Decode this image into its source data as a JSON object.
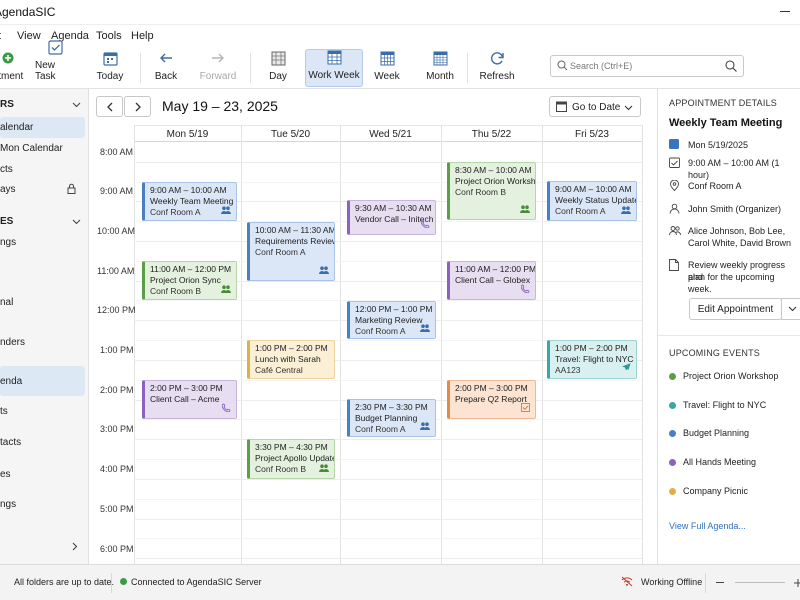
{
  "app": {
    "title": "AgendaSIC"
  },
  "menu": [
    "t",
    "View",
    "Agenda",
    "Tools",
    "Help"
  ],
  "toolbar": {
    "new_appointment": "ntment",
    "new_task": "New Task",
    "today": "Today",
    "back": "Back",
    "forward": "Forward",
    "day": "Day",
    "work_week": "Work Week",
    "week": "Week",
    "month": "Month",
    "refresh": "Refresh",
    "search_placeholder": "Search (Ctrl+E)"
  },
  "sidebar": {
    "section1_head": "RS",
    "section2_head": "ES",
    "items": [
      "alendar",
      "Mon Calendar",
      "cts",
      "ays",
      "ngs",
      "nal",
      "nders",
      "enda",
      "ts",
      "tacts",
      "es",
      "ngs"
    ]
  },
  "calendar": {
    "range": "May 19 – 23, 2025",
    "goto_label": "Go to Date",
    "days": [
      "Mon 5/19",
      "Tue 5/20",
      "Wed 5/21",
      "Thu 5/22",
      "Fri 5/23"
    ],
    "times": [
      "8:00 AM",
      "9:00 AM",
      "10:00 AM",
      "11:00 AM",
      "12:00 PM",
      "1:00 PM",
      "2:00 PM",
      "3:00 PM",
      "4:00 PM",
      "5:00 PM",
      "6:00 PM"
    ]
  },
  "events": [
    {
      "time": "9:00 AM – 10:00 AM",
      "name": "Weekly Team Meeting",
      "loc": "Conf Room A"
    },
    {
      "time": "11:00 AM – 12:00 PM",
      "name": "Project Orion Sync",
      "loc": "Conf Room B"
    },
    {
      "time": "2:00 PM – 3:00 PM",
      "name": "Client Call – Acme",
      "loc": ""
    },
    {
      "time": "10:00 AM – 11:30 AM",
      "name": "Requirements Review",
      "loc": "Conf Room A"
    },
    {
      "time": "1:00 PM – 2:00 PM",
      "name": "Lunch with Sarah",
      "loc": "Café Central"
    },
    {
      "time": "3:30 PM – 4:30 PM",
      "name": "Project Apollo Update",
      "loc": "Conf Room B"
    },
    {
      "time": "9:30 AM – 10:30 AM",
      "name": "Vendor Call – Initech",
      "loc": ""
    },
    {
      "time": "12:00 PM – 1:00 PM",
      "name": "Marketing Review",
      "loc": "Conf Room A"
    },
    {
      "time": "2:30 PM – 3:30 PM",
      "name": "Budget Planning",
      "loc": "Conf Room A"
    },
    {
      "time": "8:30 AM – 10:00 AM",
      "name": "Project Orion Workshop",
      "loc": "Conf Room B"
    },
    {
      "time": "11:00 AM – 12:00 PM",
      "name": "Client Call – Globex",
      "loc": ""
    },
    {
      "time": "2:00 PM – 3:00 PM",
      "name": "Prepare Q2 Report",
      "loc": ""
    },
    {
      "time": "9:00 AM – 10:00 AM",
      "name": "Weekly Status Update",
      "loc": "Conf Room A"
    },
    {
      "time": "1:00 PM – 2:00 PM",
      "name": "Travel: Flight to NYC",
      "loc": "AA123"
    }
  ],
  "details": {
    "head": "APPOINTMENT DETAILS",
    "title": "Weekly Team Meeting",
    "date": "Mon 5/19/2025",
    "time": "9:00 AM – 10:00 AM (1 hour)",
    "location": "Conf Room A",
    "organizer": "John Smith (Organizer)",
    "attendees_1": "Alice Johnson, Bob Lee,",
    "attendees_2": "Carol White, David Brown",
    "notes_1": "Review weekly progress and",
    "notes_2": "plan for the upcoming week.",
    "edit_label": "Edit Appointment"
  },
  "upcoming": {
    "head": "UPCOMING EVENTS",
    "items": [
      "Project Orion Workshop",
      "Travel: Flight to NYC",
      "Budget Planning",
      "All Hands Meeting",
      "Company Picnic"
    ],
    "colors": [
      "#5c9e47",
      "#3aa5a5",
      "#4a7fc4",
      "#8a63bf",
      "#e0b044"
    ],
    "view_full": "View Full Agenda..."
  },
  "status": {
    "folders": "All folders are up to date.",
    "connection": "Connected to AgendaSIC Server",
    "offline": "Working Offline"
  }
}
